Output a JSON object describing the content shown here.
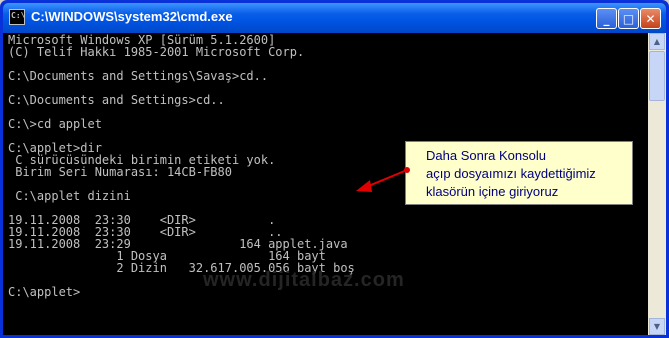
{
  "window": {
    "title": "C:\\WINDOWS\\system32\\cmd.exe",
    "icon": "cmd-icon",
    "icon_text": "C:\\"
  },
  "controls": {
    "minimize": "_",
    "maximize": "□",
    "close": "✕"
  },
  "console_lines": [
    "Microsoft Windows XP [Sürüm 5.1.2600]",
    "(C) Telif Hakkı 1985-2001 Microsoft Corp.",
    "",
    "C:\\Documents and Settings\\Savaş>cd..",
    "",
    "C:\\Documents and Settings>cd..",
    "",
    "C:\\>cd applet",
    "",
    "C:\\applet>dir",
    " C sürücüsündeki birimin etiketi yok.",
    " Birim Seri Numarası: 14CB-FB80",
    "",
    " C:\\applet dizini",
    "",
    "19.11.2008  23:30    <DIR>          .",
    "19.11.2008  23:30    <DIR>          ..",
    "19.11.2008  23:29               164 applet.java",
    "               1 Dosya              164 bayt",
    "               2 Dizin   32.617.005.056 bayt boş",
    "",
    "C:\\applet>"
  ],
  "callout": {
    "line1": "Daha Sonra Konsolu",
    "line2": "açıp dosyaımızı kaydettiğimiz",
    "line3": "klasörün içine giriyoruz"
  },
  "watermark": "www.dijitalbaz.com",
  "colors": {
    "console_bg": "#000000",
    "console_fg": "#c0c0c0",
    "callout_bg": "#ffffcc",
    "callout_text": "#000080",
    "arrow": "#e00000"
  }
}
